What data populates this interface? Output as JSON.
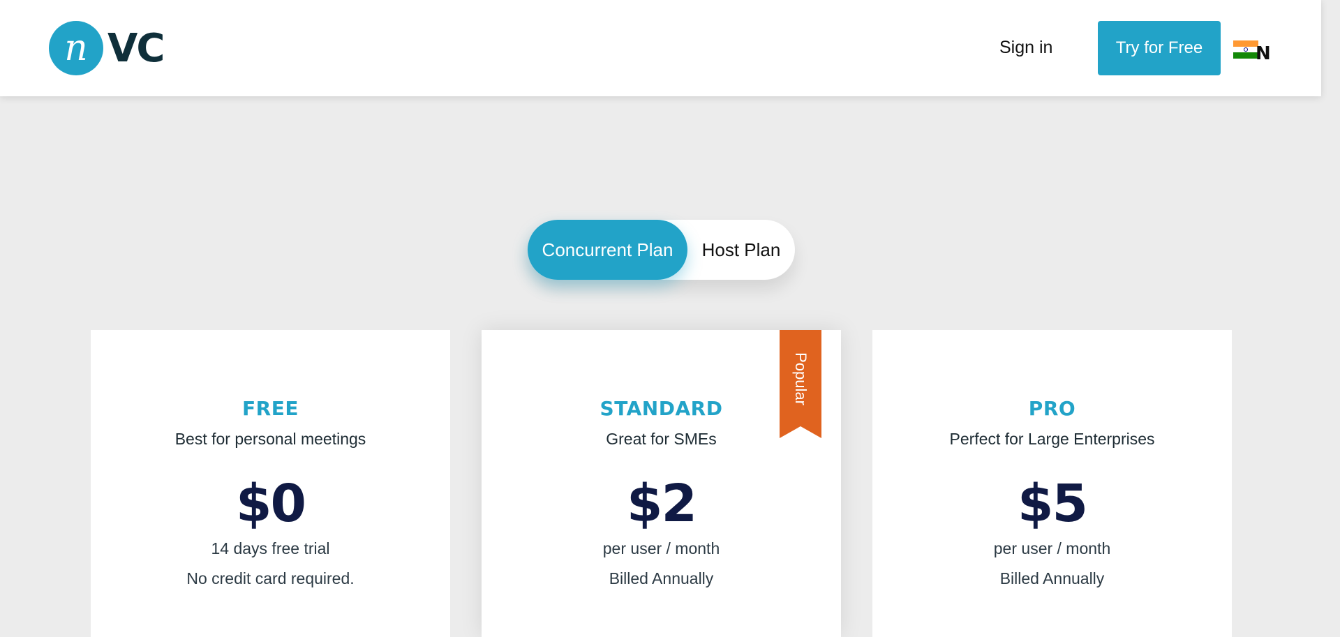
{
  "header": {
    "logo_mark": "n",
    "logo_text": "VC",
    "sign_in": "Sign in",
    "cta": "Try for Free",
    "lang_code": "N",
    "flag_icon": "india-flag-icon"
  },
  "toggle": {
    "options": [
      "Concurrent Plan",
      "Host Plan"
    ],
    "active": "Concurrent Plan"
  },
  "plans": [
    {
      "name": "FREE",
      "desc": "Best for personal meetings",
      "price": "$0",
      "line1": "14 days free trial",
      "line2": "No credit card required."
    },
    {
      "name": "STANDARD",
      "desc": "Great for SMEs",
      "price": "$2",
      "line1": "per user / month",
      "line2": "Billed Annually",
      "badge": "Popular"
    },
    {
      "name": "PRO",
      "desc": "Perfect for Large Enterprises",
      "price": "$5",
      "line1": "per user / month",
      "line2": "Billed Annually"
    }
  ],
  "colors": {
    "accent": "#22a3c8",
    "ribbon": "#e0631f",
    "price": "#101a44",
    "background": "#ececec"
  }
}
